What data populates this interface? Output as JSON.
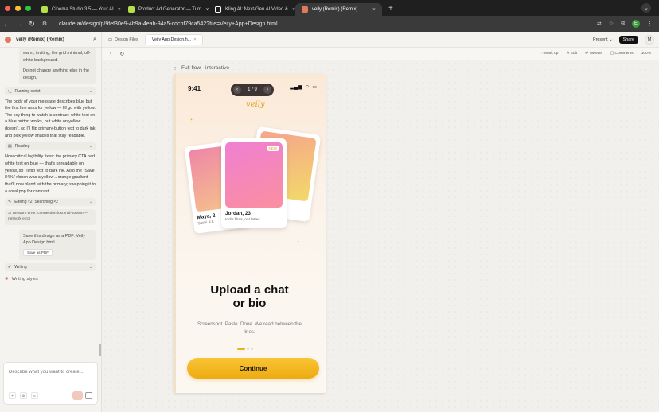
{
  "browser": {
    "tabs": [
      {
        "label": "Cinema Studio 3.5 — Your AI",
        "color": "#b6e04a"
      },
      {
        "label": "Product Ad Generator — Turn",
        "color": "#b6e04a"
      },
      {
        "label": "Kling AI: Next-Gen AI Video &",
        "color": "#ffffff"
      },
      {
        "label": "veily (Remix) (Remix)",
        "color": "#e07a5f"
      }
    ],
    "url": "claude.ai/design/p/9fef30e9-4b9a-4eab-94a5-cdcbf79ca542?file=Veily+App+Design.html",
    "profile_initial": "E"
  },
  "left": {
    "title": "veily (Remix) (Remix)",
    "msg_tail": "warm, inviting, the grid minimal, off-white background.",
    "msg_tail2": "Do not change anything else in the design.",
    "pill_running": "Running script",
    "para1": "The body of your message describes blue but the first line asks for yellow — I'll go with yellow. The key thing to watch is contrast: white text on a blue button works, but white on yellow doesn't, so I'll flip primary-button text to dark ink and pick yellow shades that stay readable.",
    "pill_reading": "Reading",
    "para2": "Now critical legibility fixes: the primary CTA had white text on blue — that's unreadable on yellow, so I'll flip text to dark ink. Also the \"Save 84%\" ribbon was a yellow→orange gradient that'll now blend with the primary; swapping it to a coral pop for contrast.",
    "pill_editing": "Editing ×2, Searching ×2",
    "error": "Network error: connection lost mid-stream — network error",
    "save_msg": "Save this design as a PDF: Veily App Design.html",
    "save_btn": "Save as PDF",
    "pill_writing": "Writing",
    "writing_styles": "Writing styles",
    "composer_placeholder": "Describe what you want to create..."
  },
  "topbar": {
    "files_tab": "Design Files",
    "doc_tab": "Veily App Design.h...",
    "present": "Present",
    "share": "Share",
    "user_initial": "M"
  },
  "toolbar": {
    "markup": "Mark up",
    "edit": "Edit",
    "tweaks": "Tweaks",
    "comments": "Comments",
    "zoom": "100%"
  },
  "canvas": {
    "flow_label": "Full flow · interactive"
  },
  "phone": {
    "time": "9:41",
    "pager": "1 / 9",
    "brand": "veily",
    "cards": [
      {
        "name": "Maya, 2",
        "sub": "Sushi & k",
        "grad": [
          "#ef86a8",
          "#f6c48a"
        ]
      },
      {
        "name": "Jordan, 23",
        "sub": "Indie films, oat lattes",
        "badge": "NEW",
        "grad": [
          "#f07fd2",
          "#fa8fa0"
        ]
      },
      {
        "name": "",
        "sub": "ooz",
        "grad": [
          "#f6a58b",
          "#f2d96a"
        ]
      }
    ],
    "headline_1": "Upload a chat",
    "headline_2": "or bio",
    "subtext": "Screenshot. Paste. Done. We read between the lines.",
    "cta": "Continue"
  }
}
